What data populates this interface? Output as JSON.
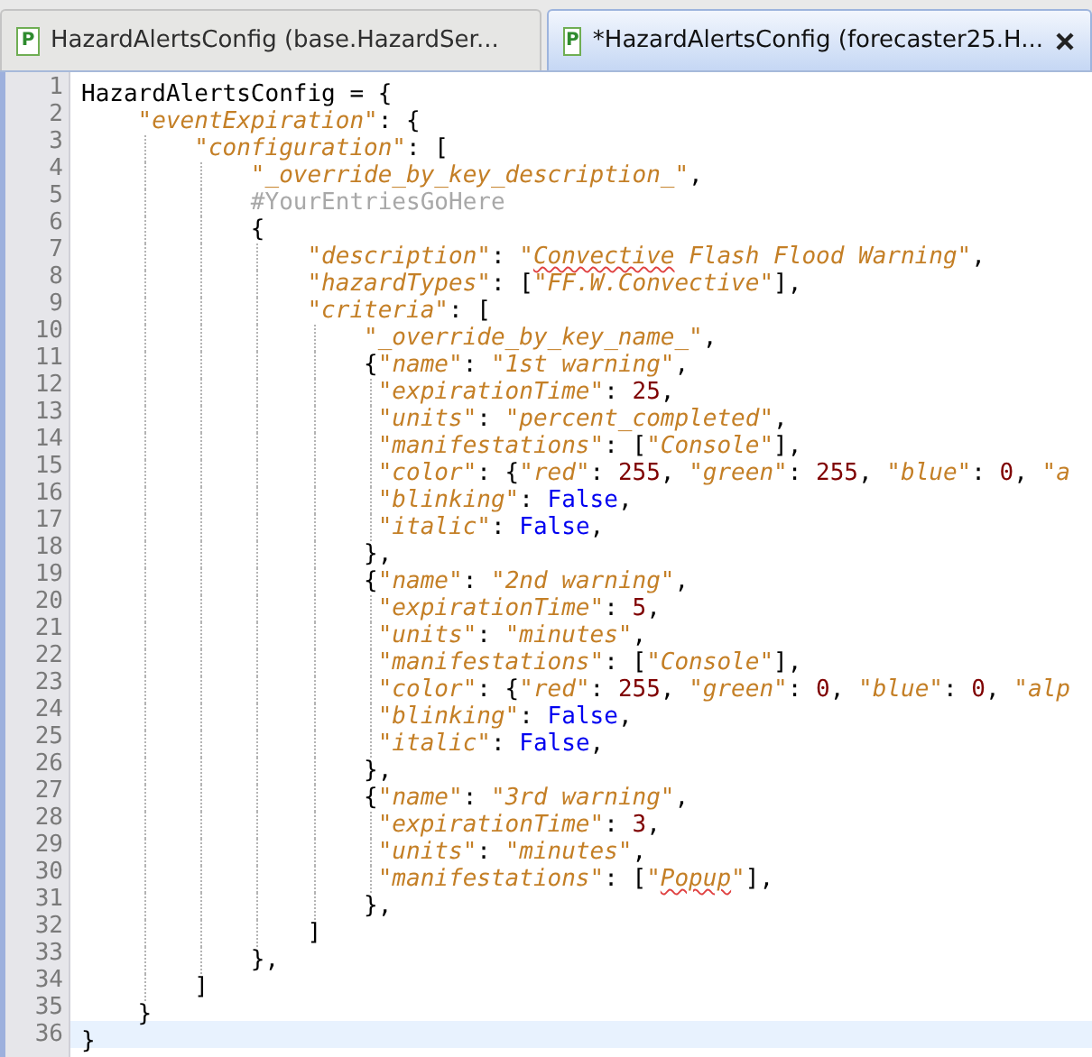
{
  "tabs": [
    {
      "icon_letter": "P",
      "label": "HazardAlertsConfig (base.HazardSer...",
      "selected": false
    },
    {
      "icon_letter": "P",
      "label": "*HazardAlertsConfig (forecaster25.H...",
      "selected": true
    }
  ],
  "editor": {
    "lines": [
      {
        "number": "1",
        "current": false,
        "tokens": [
          {
            "kind": "plain",
            "text": "HazardAlertsConfig = {"
          }
        ]
      },
      {
        "number": "2",
        "current": false,
        "tokens": [
          {
            "kind": "string",
            "text": "    \"eventExpiration\""
          },
          {
            "kind": "plain",
            "text": ": {"
          }
        ]
      },
      {
        "number": "3",
        "current": false,
        "tokens": [
          {
            "kind": "string",
            "text": "        \"configuration\""
          },
          {
            "kind": "plain",
            "text": ": ["
          }
        ]
      },
      {
        "number": "4",
        "current": false,
        "tokens": [
          {
            "kind": "string",
            "text": "            \"_override_by_key_description_\""
          },
          {
            "kind": "plain",
            "text": ","
          }
        ]
      },
      {
        "number": "5",
        "current": false,
        "tokens": [
          {
            "kind": "comment",
            "text": "            #YourEntriesGoHere"
          }
        ]
      },
      {
        "number": "6",
        "current": false,
        "tokens": [
          {
            "kind": "plain",
            "text": "            {"
          }
        ]
      },
      {
        "number": "7",
        "current": false,
        "tokens": [
          {
            "kind": "string",
            "text": "                \"description\""
          },
          {
            "kind": "plain",
            "text": ": "
          },
          {
            "kind": "string",
            "text": "\""
          },
          {
            "kind": "typo",
            "text": "Convective"
          },
          {
            "kind": "string",
            "text": " Flash Flood Warning\""
          },
          {
            "kind": "plain",
            "text": ","
          }
        ]
      },
      {
        "number": "8",
        "current": false,
        "tokens": [
          {
            "kind": "string",
            "text": "                \"hazardTypes\""
          },
          {
            "kind": "plain",
            "text": ": ["
          },
          {
            "kind": "string",
            "text": "\"FF.W.Convective\""
          },
          {
            "kind": "plain",
            "text": "],"
          }
        ]
      },
      {
        "number": "9",
        "current": false,
        "tokens": [
          {
            "kind": "string",
            "text": "                \"criteria\""
          },
          {
            "kind": "plain",
            "text": ": ["
          }
        ]
      },
      {
        "number": "10",
        "current": false,
        "tokens": [
          {
            "kind": "string",
            "text": "                    \"_override_by_key_name_\""
          },
          {
            "kind": "plain",
            "text": ","
          }
        ]
      },
      {
        "number": "11",
        "current": false,
        "tokens": [
          {
            "kind": "plain",
            "text": "                    {"
          },
          {
            "kind": "string",
            "text": "\"name\""
          },
          {
            "kind": "plain",
            "text": ": "
          },
          {
            "kind": "string",
            "text": "\"1st warning\""
          },
          {
            "kind": "plain",
            "text": ","
          }
        ]
      },
      {
        "number": "12",
        "current": false,
        "tokens": [
          {
            "kind": "string",
            "text": "                     \"expirationTime\""
          },
          {
            "kind": "plain",
            "text": ": "
          },
          {
            "kind": "number",
            "text": "25"
          },
          {
            "kind": "plain",
            "text": ","
          }
        ]
      },
      {
        "number": "13",
        "current": false,
        "tokens": [
          {
            "kind": "string",
            "text": "                     \"units\""
          },
          {
            "kind": "plain",
            "text": ": "
          },
          {
            "kind": "string",
            "text": "\"percent_completed\""
          },
          {
            "kind": "plain",
            "text": ","
          }
        ]
      },
      {
        "number": "14",
        "current": false,
        "tokens": [
          {
            "kind": "string",
            "text": "                     \"manifestations\""
          },
          {
            "kind": "plain",
            "text": ": ["
          },
          {
            "kind": "string",
            "text": "\"Console\""
          },
          {
            "kind": "plain",
            "text": "],"
          }
        ]
      },
      {
        "number": "15",
        "current": false,
        "tokens": [
          {
            "kind": "string",
            "text": "                     \"color\""
          },
          {
            "kind": "plain",
            "text": ": {"
          },
          {
            "kind": "string",
            "text": "\"red\""
          },
          {
            "kind": "plain",
            "text": ": "
          },
          {
            "kind": "number",
            "text": "255"
          },
          {
            "kind": "plain",
            "text": ", "
          },
          {
            "kind": "string",
            "text": "\"green\""
          },
          {
            "kind": "plain",
            "text": ": "
          },
          {
            "kind": "number",
            "text": "255"
          },
          {
            "kind": "plain",
            "text": ", "
          },
          {
            "kind": "string",
            "text": "\"blue\""
          },
          {
            "kind": "plain",
            "text": ": "
          },
          {
            "kind": "number",
            "text": "0"
          },
          {
            "kind": "plain",
            "text": ", "
          },
          {
            "kind": "string",
            "text": "\"a"
          }
        ]
      },
      {
        "number": "16",
        "current": false,
        "tokens": [
          {
            "kind": "string",
            "text": "                     \"blinking\""
          },
          {
            "kind": "plain",
            "text": ": "
          },
          {
            "kind": "keyword",
            "text": "False"
          },
          {
            "kind": "plain",
            "text": ","
          }
        ]
      },
      {
        "number": "17",
        "current": false,
        "tokens": [
          {
            "kind": "string",
            "text": "                     \"italic\""
          },
          {
            "kind": "plain",
            "text": ": "
          },
          {
            "kind": "keyword",
            "text": "False"
          },
          {
            "kind": "plain",
            "text": ","
          }
        ]
      },
      {
        "number": "18",
        "current": false,
        "tokens": [
          {
            "kind": "plain",
            "text": "                    },"
          }
        ]
      },
      {
        "number": "19",
        "current": false,
        "tokens": [
          {
            "kind": "plain",
            "text": "                    {"
          },
          {
            "kind": "string",
            "text": "\"name\""
          },
          {
            "kind": "plain",
            "text": ": "
          },
          {
            "kind": "string",
            "text": "\"2nd warning\""
          },
          {
            "kind": "plain",
            "text": ","
          }
        ]
      },
      {
        "number": "20",
        "current": false,
        "tokens": [
          {
            "kind": "string",
            "text": "                     \"expirationTime\""
          },
          {
            "kind": "plain",
            "text": ": "
          },
          {
            "kind": "number",
            "text": "5"
          },
          {
            "kind": "plain",
            "text": ","
          }
        ]
      },
      {
        "number": "21",
        "current": false,
        "tokens": [
          {
            "kind": "string",
            "text": "                     \"units\""
          },
          {
            "kind": "plain",
            "text": ": "
          },
          {
            "kind": "string",
            "text": "\"minutes\""
          },
          {
            "kind": "plain",
            "text": ","
          }
        ]
      },
      {
        "number": "22",
        "current": false,
        "tokens": [
          {
            "kind": "string",
            "text": "                     \"manifestations\""
          },
          {
            "kind": "plain",
            "text": ": ["
          },
          {
            "kind": "string",
            "text": "\"Console\""
          },
          {
            "kind": "plain",
            "text": "],"
          }
        ]
      },
      {
        "number": "23",
        "current": false,
        "tokens": [
          {
            "kind": "string",
            "text": "                     \"color\""
          },
          {
            "kind": "plain",
            "text": ": {"
          },
          {
            "kind": "string",
            "text": "\"red\""
          },
          {
            "kind": "plain",
            "text": ": "
          },
          {
            "kind": "number",
            "text": "255"
          },
          {
            "kind": "plain",
            "text": ", "
          },
          {
            "kind": "string",
            "text": "\"green\""
          },
          {
            "kind": "plain",
            "text": ": "
          },
          {
            "kind": "number",
            "text": "0"
          },
          {
            "kind": "plain",
            "text": ", "
          },
          {
            "kind": "string",
            "text": "\"blue\""
          },
          {
            "kind": "plain",
            "text": ": "
          },
          {
            "kind": "number",
            "text": "0"
          },
          {
            "kind": "plain",
            "text": ", "
          },
          {
            "kind": "string",
            "text": "\"alp"
          }
        ]
      },
      {
        "number": "24",
        "current": false,
        "tokens": [
          {
            "kind": "string",
            "text": "                     \"blinking\""
          },
          {
            "kind": "plain",
            "text": ": "
          },
          {
            "kind": "keyword",
            "text": "False"
          },
          {
            "kind": "plain",
            "text": ","
          }
        ]
      },
      {
        "number": "25",
        "current": false,
        "tokens": [
          {
            "kind": "string",
            "text": "                     \"italic\""
          },
          {
            "kind": "plain",
            "text": ": "
          },
          {
            "kind": "keyword",
            "text": "False"
          },
          {
            "kind": "plain",
            "text": ","
          }
        ]
      },
      {
        "number": "26",
        "current": false,
        "tokens": [
          {
            "kind": "plain",
            "text": "                    },"
          }
        ]
      },
      {
        "number": "27",
        "current": false,
        "tokens": [
          {
            "kind": "plain",
            "text": "                    {"
          },
          {
            "kind": "string",
            "text": "\"name\""
          },
          {
            "kind": "plain",
            "text": ": "
          },
          {
            "kind": "string",
            "text": "\"3rd warning\""
          },
          {
            "kind": "plain",
            "text": ","
          }
        ]
      },
      {
        "number": "28",
        "current": false,
        "tokens": [
          {
            "kind": "string",
            "text": "                     \"expirationTime\""
          },
          {
            "kind": "plain",
            "text": ": "
          },
          {
            "kind": "number",
            "text": "3"
          },
          {
            "kind": "plain",
            "text": ","
          }
        ]
      },
      {
        "number": "29",
        "current": false,
        "tokens": [
          {
            "kind": "string",
            "text": "                     \"units\""
          },
          {
            "kind": "plain",
            "text": ": "
          },
          {
            "kind": "string",
            "text": "\"minutes\""
          },
          {
            "kind": "plain",
            "text": ","
          }
        ]
      },
      {
        "number": "30",
        "current": false,
        "tokens": [
          {
            "kind": "string",
            "text": "                     \"manifestations\""
          },
          {
            "kind": "plain",
            "text": ": ["
          },
          {
            "kind": "string",
            "text": "\""
          },
          {
            "kind": "typo",
            "text": "Popup"
          },
          {
            "kind": "string",
            "text": "\""
          },
          {
            "kind": "plain",
            "text": "],"
          }
        ]
      },
      {
        "number": "31",
        "current": false,
        "tokens": [
          {
            "kind": "plain",
            "text": "                    },"
          }
        ]
      },
      {
        "number": "32",
        "current": false,
        "tokens": [
          {
            "kind": "plain",
            "text": "                ]"
          }
        ]
      },
      {
        "number": "33",
        "current": false,
        "tokens": [
          {
            "kind": "plain",
            "text": "            },"
          }
        ]
      },
      {
        "number": "34",
        "current": false,
        "tokens": [
          {
            "kind": "plain",
            "text": "        ]"
          }
        ]
      },
      {
        "number": "35",
        "current": false,
        "tokens": [
          {
            "kind": "plain",
            "text": "    }"
          }
        ]
      },
      {
        "number": "36",
        "current": true,
        "tokens": [
          {
            "kind": "plain",
            "text": "}"
          }
        ]
      }
    ]
  }
}
